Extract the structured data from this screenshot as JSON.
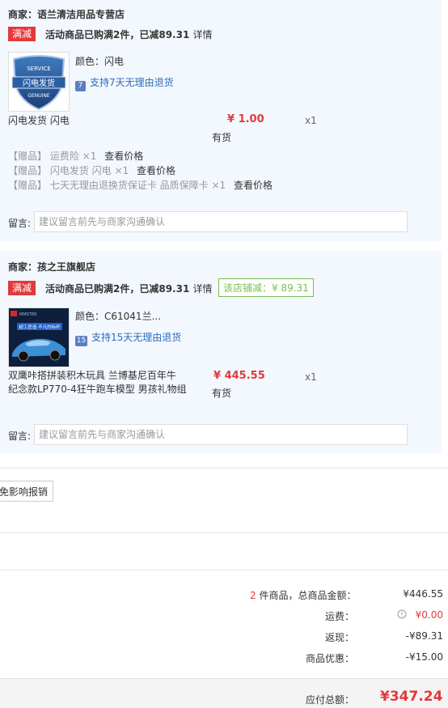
{
  "shop1": {
    "name": "商家：语兰清洁用品专营店",
    "promo_tag": "满减",
    "promo_text": "活动商品已购满2件，已减89.31",
    "promo_detail": "详情",
    "item": {
      "thumb_top": "SERVICE",
      "thumb_mid": "闪电发货",
      "thumb_bottom": "GENUINE",
      "color_label": "颜色：",
      "color_value": "闪电",
      "service_icon": "7",
      "service_text": "支持7天无理由退货",
      "name": "闪电发货 闪电",
      "price": "¥ 1.00",
      "qty": "x1",
      "stock": "有货"
    },
    "gifts": [
      {
        "tag": "【赠品】",
        "name": "运费险 ×1",
        "check": "查看价格"
      },
      {
        "tag": "【赠品】",
        "name": "闪电发货 闪电 ×1",
        "check": "查看价格"
      },
      {
        "tag": "【赠品】",
        "name": "七天无理由退换货保证卡 品质保障卡 ×1",
        "check": "查看价格"
      }
    ],
    "remark_label": "留言:",
    "remark_placeholder": "建议留言前先与商家沟通确认"
  },
  "shop2": {
    "name": "商家：孩之王旗舰店",
    "promo_tag": "满减",
    "promo_text": "活动商品已购满2件，已减89.31",
    "promo_detail": "详情",
    "save_text": "该店铺减：¥ 89.31",
    "item": {
      "thumb_brand": "MMSTER",
      "thumb_banner": "超工匠造 不凡的标杆",
      "color_label": "颜色：",
      "color_value": "C61041兰...",
      "service_icon": "15",
      "service_text": "支持15天无理由退货",
      "name_line1": "双鹰咔搭拼装积木玩具 兰博基尼百年牛",
      "name_line2": "纪念款LP770-4狂牛跑车模型 男孩礼物组",
      "price": "¥ 445.55",
      "qty": "x1",
      "stock": "有货"
    },
    "remark_label": "留言:",
    "remark_placeholder": "建议留言前先与商家沟通确认"
  },
  "invoice_button": "免影响报销",
  "summary": {
    "count": "2",
    "count_label": "件商品，总商品金额：",
    "goods_total": "¥446.55",
    "freight_label": "运费：",
    "freight": "¥0.00",
    "cashback_label": "返现：",
    "cashback": "-¥89.31",
    "discount_label": "商品优惠：",
    "discount": "-¥15.00",
    "payable_label": "应付总额：",
    "payable": "¥347.24"
  },
  "colors": {
    "accent_red": "#e4393c",
    "shop_bg": "#f3f8fe",
    "save_green": "#7abd54",
    "link_blue": "#2d6bb8"
  }
}
